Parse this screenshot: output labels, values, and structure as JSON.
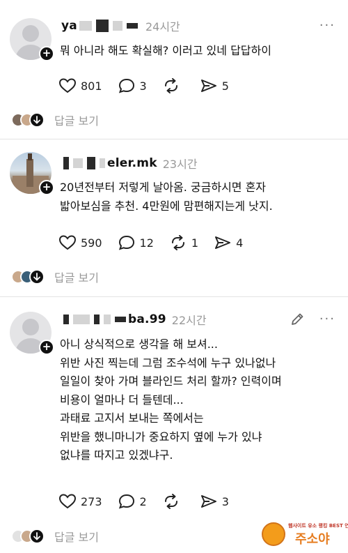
{
  "posts": [
    {
      "username_visible_start": "ya",
      "username_visible_end": "",
      "time": "24시간",
      "content": "뭐 아니라 해도 확실해? 이러고 있네 답답하이",
      "likes": "801",
      "comments": "3",
      "reposts": "",
      "shares": "5",
      "replies_label": "답글 보기"
    },
    {
      "username_visible_start": "",
      "username_visible_end": "eler.mk",
      "time": "23시간",
      "content": "20년전부터 저렇게 날아옴. 궁금하시면 혼자\n밟아보심을 추천. 4만원에 맘편해지는게 낫지.",
      "likes": "590",
      "comments": "12",
      "reposts": "1",
      "shares": "4",
      "replies_label": "답글 보기"
    },
    {
      "username_visible_start": "",
      "username_visible_end": "ba.99",
      "time": "22시간",
      "content": "아니 상식적으로 생각을 해 보셔...\n위반 사진 찍는데 그럼 조수석에 누구 있나없나\n일일이 찾아 가며 블라인드 처리 할까? 인력이며\n비용이 얼마나 더 들텐데...\n과태료 고지서 보내는 쪽에서는\n위반을 했니마니가 중요하지 옆에 누가 있냐\n없냐를 따지고 있겠냐구.",
      "likes": "273",
      "comments": "2",
      "reposts": "",
      "shares": "3",
      "replies_label": "답글 보기"
    }
  ],
  "ui": {
    "more_glyph": "···"
  },
  "watermark": {
    "small": "웹사이트 유소 랭킹 BEST 연의",
    "big": "주소야"
  },
  "icons": {
    "like": "heart-icon",
    "comment": "comment-bubble-icon",
    "repost": "repost-icon",
    "share": "send-icon",
    "follow": "plus-icon",
    "edit": "pencil-icon",
    "expand": "arrow-down-icon"
  }
}
